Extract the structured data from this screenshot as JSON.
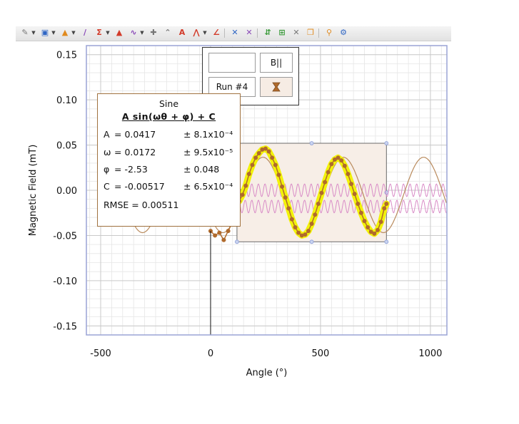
{
  "toolbar": {
    "icons": [
      "edit-icon",
      "select-data-icon",
      "stats-icon",
      "fit-icon",
      "integral-icon",
      "tangent-icon",
      "curve-fit-icon",
      "examine-icon",
      "annotate-icon",
      "text-annotation-icon",
      "model-icon",
      "slope-icon",
      "connect-points-icon",
      "disconnect-points-icon",
      "add-column-icon",
      "show-data-icon",
      "remove-icon",
      "copy-icon",
      "pin-icon",
      "settings-icon"
    ],
    "colors": {
      "red": "#d23b2a",
      "blue": "#2f66c4",
      "green": "#3a9a3a",
      "orange": "#e08a1e",
      "purple": "#8a4ab8",
      "gray": "#777777"
    }
  },
  "legend": {
    "blank_label": "",
    "b_label": "B||",
    "run_label": "Run #4"
  },
  "fit": {
    "title": "Sine",
    "equation": "A sin(ωθ + φ) + C",
    "rows": [
      {
        "name": "A",
        "value": "= 0.0417",
        "error": "± 8.1x10⁻⁴"
      },
      {
        "name": "ω",
        "value": "= 0.0172",
        "error": "± 9.5x10⁻⁵"
      },
      {
        "name": "φ",
        "value": "= -2.53",
        "error": "± 0.048"
      },
      {
        "name": "C",
        "value": "= -0.00517",
        "error": "± 6.5x10⁻⁴"
      }
    ],
    "rmse": "RMSE = 0.00511"
  },
  "chart_data": {
    "type": "line",
    "xlabel": "Angle (°)",
    "ylabel": "Magnetic Field (mT)",
    "xlim": [
      -565,
      1075
    ],
    "ylim": [
      -0.16,
      0.16
    ],
    "xticks": [
      "-500",
      "0",
      "500",
      "1000"
    ],
    "yticks": [
      "0.15",
      "0.10",
      "0.05",
      "0.00",
      "-0.05",
      "-0.10",
      "-0.15"
    ],
    "grid": true,
    "cursor_x": 0,
    "selection": {
      "x_start": 120,
      "x_end": 800,
      "y_min": -0.057,
      "y_max": 0.052
    },
    "fit_curve": {
      "A": 0.0417,
      "omega": 0.0172,
      "phi": -2.53,
      "C": -0.00517,
      "x_range": [
        -400,
        1075
      ]
    },
    "data_points": {
      "x": [
        0,
        20,
        40,
        60,
        80,
        100,
        115,
        130,
        145,
        160,
        175,
        190,
        205,
        220,
        235,
        250,
        265,
        280,
        295,
        310,
        325,
        340,
        355,
        370,
        385,
        400,
        415,
        430,
        445,
        460,
        475,
        490,
        505,
        520,
        535,
        550,
        565,
        580,
        595,
        610,
        625,
        640,
        655,
        670,
        685,
        700,
        715,
        730,
        745,
        760,
        775,
        790,
        800
      ],
      "y": [
        -0.045,
        -0.05,
        -0.047,
        -0.055,
        -0.045,
        -0.035,
        -0.02,
        -0.012,
        -0.005,
        0.005,
        0.018,
        0.028,
        0.036,
        0.041,
        0.045,
        0.046,
        0.043,
        0.036,
        0.028,
        0.017,
        0.004,
        -0.008,
        -0.02,
        -0.032,
        -0.041,
        -0.047,
        -0.05,
        -0.049,
        -0.045,
        -0.037,
        -0.027,
        -0.015,
        -0.003,
        0.009,
        0.02,
        0.029,
        0.034,
        0.036,
        0.033,
        0.027,
        0.018,
        0.007,
        -0.004,
        -0.015,
        -0.025,
        -0.034,
        -0.041,
        -0.046,
        -0.048,
        -0.044,
        -0.035,
        -0.02,
        -0.015
      ]
    },
    "reference_wave": {
      "amplitude": 0.007,
      "period_deg": 30,
      "offsets": [
        0.0,
        -0.018
      ],
      "x_range": [
        120,
        1075
      ]
    },
    "colors": {
      "data": "#b06a2c",
      "fit": "#b98a5c",
      "highlight": "#f2f20a",
      "reference": "#d98cc7",
      "grid": "#e6e6e6",
      "axis": "#9aa4d6",
      "selection_fill": "#f7eee7",
      "selection_border": "#6b6b6b",
      "cursor": "#111111"
    }
  }
}
